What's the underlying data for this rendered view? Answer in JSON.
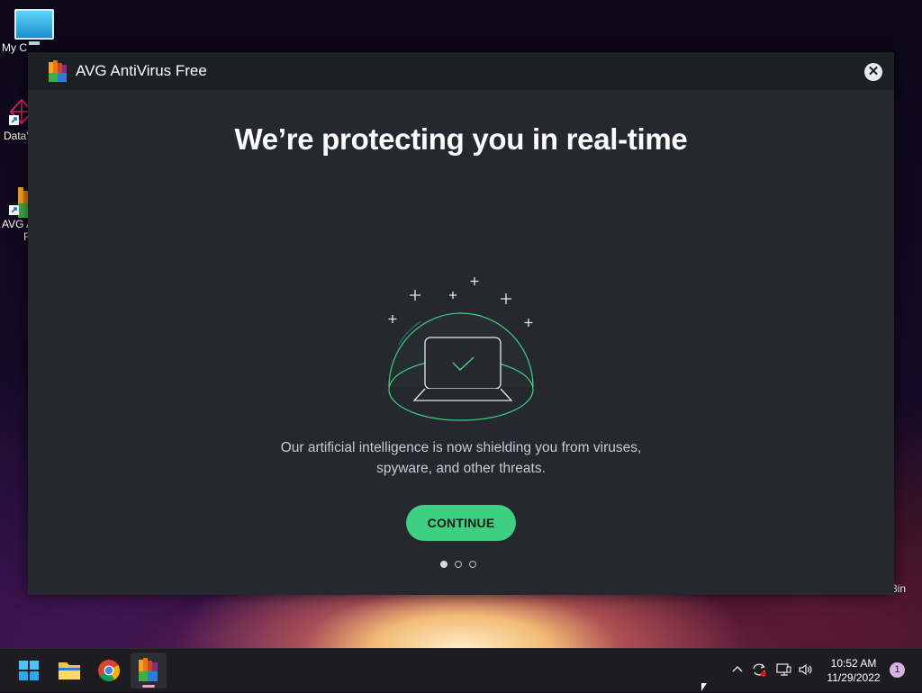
{
  "desktop": {
    "icons": [
      {
        "label": "My C"
      },
      {
        "label": "DataV"
      },
      {
        "label": "AVG A"
      },
      {
        "label": "F"
      }
    ],
    "recycle_bin_label": "3in"
  },
  "window": {
    "title": "AVG AntiVirus Free",
    "close_symbol": "✕",
    "headline": "We’re protecting you in real-time",
    "description_line1": "Our artificial intelligence is now shielding you from viruses,",
    "description_line2": "spyware, and other threats.",
    "continue_label": "CONTINUE",
    "pagination": {
      "total": 3,
      "active": 1
    },
    "accent_color": "#3fcf82"
  },
  "taskbar": {
    "apps": [
      {
        "name": "start-icon"
      },
      {
        "name": "file-explorer-icon"
      },
      {
        "name": "chrome-icon"
      },
      {
        "name": "avg-icon",
        "active": true
      }
    ],
    "tray": {
      "chevron": "^",
      "time": "10:52 AM",
      "date": "11/29/2022",
      "notification_count": "1"
    }
  }
}
